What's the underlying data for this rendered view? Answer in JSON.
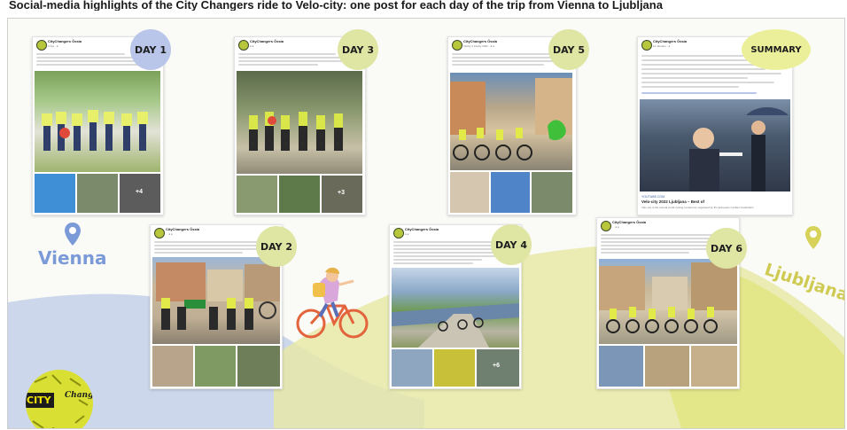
{
  "banner": {
    "text": "Social-media highlights of the City Changers ride to Velo-city: one post for each day of the trip from Vienna to Ljubljana"
  },
  "cities": {
    "start": "Vienna",
    "end": "Ljubljana"
  },
  "logo": {
    "city": "CITY",
    "changers": "Changers"
  },
  "colors": {
    "badge_blue": "#b9c6ea",
    "badge_green": "#dfe6a4",
    "badge_summary": "#ecef9a",
    "wave_blue": "#bccbe8",
    "wave_green": "#e6e9a8"
  },
  "posts": [
    {
      "id": "day1",
      "badge": "DAY 1",
      "page": "CityChangers Össia",
      "meta": "2 tips · ●",
      "more": "+4",
      "icons": [
        "avatar-icon",
        "globe-icon"
      ]
    },
    {
      "id": "day3",
      "badge": "DAY 3",
      "page": "CityChangers Össia",
      "meta": "● ●",
      "more": "+3"
    },
    {
      "id": "day5",
      "badge": "DAY 5",
      "page": "CityChangers Össia",
      "meta": "Inkcity 2 Inkcity 2022 · ● ●",
      "more": ""
    },
    {
      "id": "summary",
      "badge": "SUMMARY",
      "page": "CityChangers Össia",
      "meta": "12 January · ●",
      "more": "",
      "link_caption": "Velo-city 2022 Ljubljana – Best of",
      "link_sub": "Velo-city is the annual world cycling conference organised by the European Cyclists' Federation",
      "link_domain": "YOUTUBE.COM"
    },
    {
      "id": "day2",
      "badge": "DAY 2",
      "page": "CityChangers Össia",
      "meta": "... ● ●",
      "more": ""
    },
    {
      "id": "day4",
      "badge": "DAY 4",
      "page": "CityChangers Össia",
      "meta": "● ●",
      "more": "+6"
    },
    {
      "id": "day6",
      "badge": "DAY 6",
      "page": "CityChangers Össia",
      "meta": "... ● ●",
      "more": ""
    }
  ]
}
